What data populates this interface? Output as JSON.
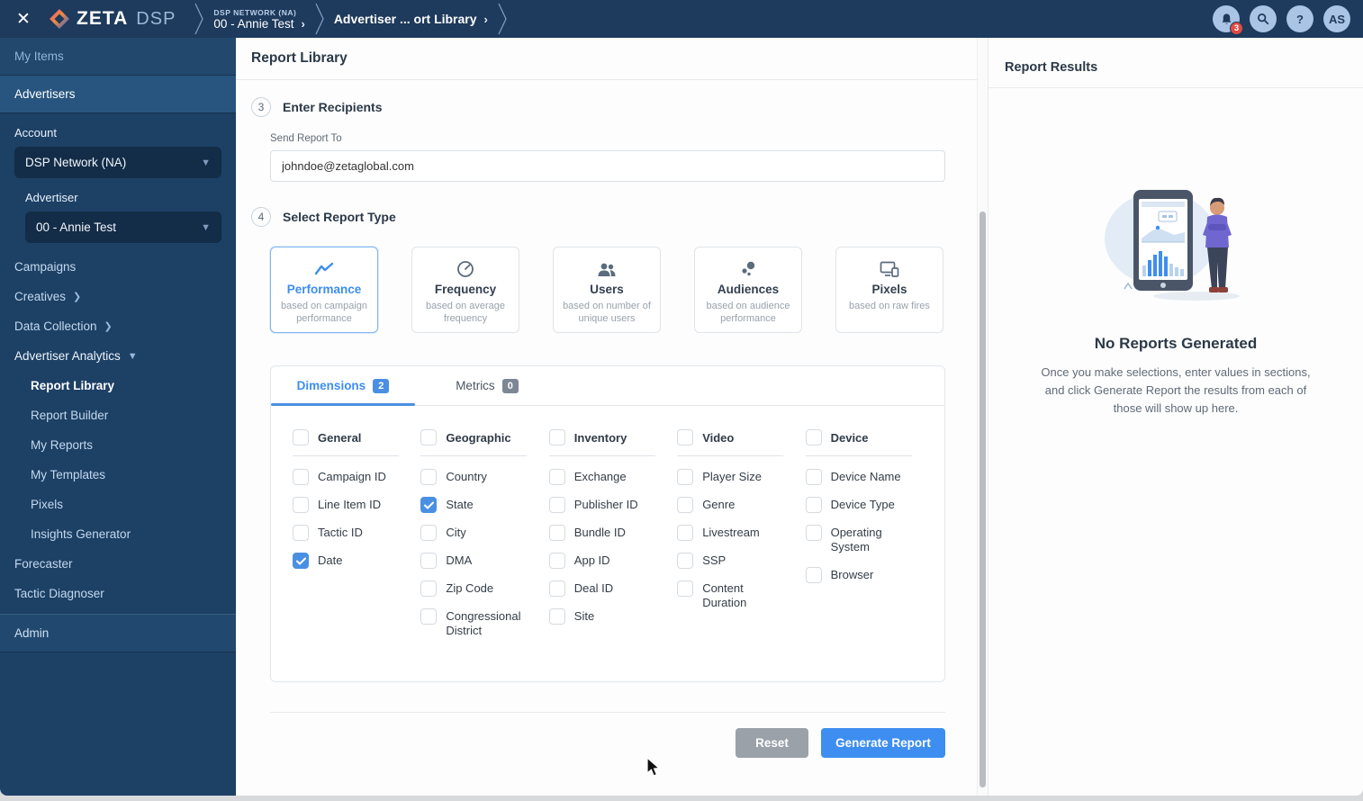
{
  "navbar": {
    "brand": "ZETA",
    "product": "DSP",
    "breadcrumb_network_eyebrow": "DSP NETWORK (NA)",
    "breadcrumb_network": "00 - Annie Test",
    "breadcrumb_page": "Advertiser ... ort Library",
    "notification_count": "3",
    "help_label": "?",
    "avatar_initials": "AS"
  },
  "sidebar": {
    "my_items": "My Items",
    "advertisers": "Advertisers",
    "account_label": "Account",
    "account_value": "DSP Network (NA)",
    "advertiser_label": "Advertiser",
    "advertiser_value": "00 - Annie Test",
    "nav": [
      {
        "label": "Campaigns",
        "chevron": "none",
        "type": "item"
      },
      {
        "label": "Creatives",
        "chevron": "right",
        "type": "item"
      },
      {
        "label": "Data Collection",
        "chevron": "right",
        "type": "item"
      },
      {
        "label": "Advertiser Analytics",
        "chevron": "down",
        "type": "group"
      },
      {
        "label": "Report Library",
        "type": "sub",
        "active": true
      },
      {
        "label": "Report Builder",
        "type": "sub"
      },
      {
        "label": "My Reports",
        "type": "sub"
      },
      {
        "label": "My Templates",
        "type": "sub"
      },
      {
        "label": "Pixels",
        "type": "sub"
      },
      {
        "label": "Insights Generator",
        "type": "sub"
      },
      {
        "label": "Forecaster",
        "chevron": "none",
        "type": "item"
      },
      {
        "label": "Tactic Diagnoser",
        "chevron": "none",
        "type": "item"
      }
    ],
    "admin": "Admin"
  },
  "main": {
    "page_title": "Report Library",
    "step3_number": "3",
    "step3_title": "Enter Recipients",
    "send_report_label": "Send Report To",
    "send_report_value": "johndoe@zetaglobal.com",
    "step4_number": "4",
    "step4_title": "Select Report Type",
    "report_types": [
      {
        "label": "Performance",
        "desc": "based on campaign performance",
        "icon": "line-chart-icon",
        "selected": true
      },
      {
        "label": "Frequency",
        "desc": "based on average frequency",
        "icon": "gauge-icon",
        "selected": false
      },
      {
        "label": "Users",
        "desc": "based on number of unique users",
        "icon": "users-icon",
        "selected": false
      },
      {
        "label": "Audiences",
        "desc": "based on audience performance",
        "icon": "audience-dots-icon",
        "selected": false
      },
      {
        "label": "Pixels",
        "desc": "based on raw fires",
        "icon": "devices-icon",
        "selected": false
      }
    ],
    "tabs": [
      {
        "label": "Dimensions",
        "count": "2",
        "active": true
      },
      {
        "label": "Metrics",
        "count": "0",
        "active": false
      }
    ],
    "dimension_columns": [
      {
        "header": "General",
        "header_checked": false,
        "items": [
          {
            "label": "Campaign ID",
            "checked": false
          },
          {
            "label": "Line Item ID",
            "checked": false
          },
          {
            "label": "Tactic ID",
            "checked": false
          },
          {
            "label": "Date",
            "checked": true
          }
        ]
      },
      {
        "header": "Geographic",
        "header_checked": false,
        "items": [
          {
            "label": "Country",
            "checked": false
          },
          {
            "label": "State",
            "checked": true
          },
          {
            "label": "City",
            "checked": false
          },
          {
            "label": "DMA",
            "checked": false
          },
          {
            "label": "Zip Code",
            "checked": false
          },
          {
            "label": "Congressional District",
            "checked": false
          }
        ]
      },
      {
        "header": "Inventory",
        "header_checked": false,
        "items": [
          {
            "label": "Exchange",
            "checked": false
          },
          {
            "label": "Publisher ID",
            "checked": false
          },
          {
            "label": "Bundle ID",
            "checked": false
          },
          {
            "label": "App ID",
            "checked": false
          },
          {
            "label": "Deal ID",
            "checked": false
          },
          {
            "label": "Site",
            "checked": false
          }
        ]
      },
      {
        "header": "Video",
        "header_checked": false,
        "items": [
          {
            "label": "Player Size",
            "checked": false
          },
          {
            "label": "Genre",
            "checked": false
          },
          {
            "label": "Livestream",
            "checked": false
          },
          {
            "label": "SSP",
            "checked": false
          },
          {
            "label": "Content Duration",
            "checked": false
          }
        ]
      },
      {
        "header": "Device",
        "header_checked": false,
        "items": [
          {
            "label": "Device Name",
            "checked": false
          },
          {
            "label": "Device Type",
            "checked": false
          },
          {
            "label": "Operating System",
            "checked": false
          },
          {
            "label": "Browser",
            "checked": false
          }
        ]
      }
    ],
    "reset_label": "Reset",
    "generate_label": "Generate Report"
  },
  "results_panel": {
    "title": "Report Results",
    "empty_title": "No Reports Generated",
    "empty_desc": "Once you make selections, enter values in sections, and click Generate Report the results from each of those will show up here."
  },
  "colors": {
    "accent_blue": "#3d8ef0",
    "checkbox_blue": "#4a90e2",
    "navbar_navy": "#1e3a5c",
    "sidebar_navy": "#1d4065",
    "badge_red": "#e14b44",
    "reset_gray": "#9aa1a9"
  }
}
